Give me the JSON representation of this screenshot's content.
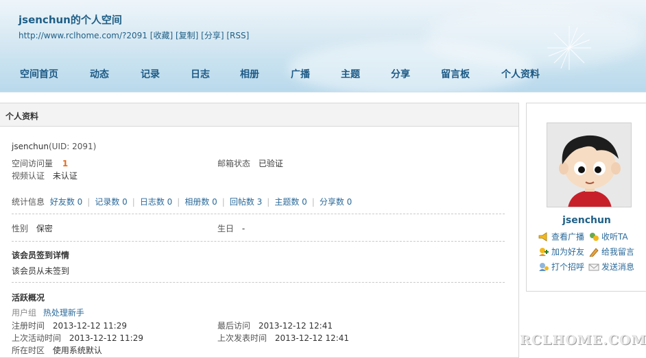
{
  "header": {
    "title": "jsenchun的个人空间",
    "url": "http://www.rclhome.com/?2091",
    "link_collect": "[收藏]",
    "link_copy": "[复制]",
    "link_share": "[分享]",
    "link_rss": "[RSS]"
  },
  "nav": [
    "空间首页",
    "动态",
    "记录",
    "日志",
    "相册",
    "广播",
    "主题",
    "分享",
    "留言板",
    "个人资料"
  ],
  "panel": {
    "heading": "个人资料",
    "username": "jsenchun",
    "uid": "(UID: 2091)",
    "visits_label": "空间访问量",
    "visits_value": "1",
    "email_label": "邮箱状态",
    "email_value": "已验证",
    "video_label": "视频认证",
    "video_value": "未认证",
    "stats_label": "统计信息",
    "stats": [
      "好友数 0",
      "记录数 0",
      "日志数 0",
      "相册数 0",
      "回帖数 3",
      "主题数 0",
      "分享数 0"
    ],
    "gender_label": "性别",
    "gender_value": "保密",
    "birthday_label": "生日",
    "birthday_value": "-",
    "checkin_title": "该会员签到详情",
    "checkin_text": "该会员从未签到",
    "activity_title": "活跃概况",
    "group_label": "用户组",
    "group_value": "热处理新手",
    "reg_label": "注册时间",
    "reg_value": "2013-12-12 11:29",
    "last_visit_label": "最后访问",
    "last_visit_value": "2013-12-12 12:41",
    "last_active_label": "上次活动时间",
    "last_active_value": "2013-12-12 11:29",
    "last_post_label": "上次发表时间",
    "last_post_value": "2013-12-12 12:41",
    "timezone_label": "所在时区",
    "timezone_value": "使用系统默认"
  },
  "side": {
    "username": "jsenchun",
    "actions": [
      {
        "label": "查看广播",
        "icon": "broadcast-icon"
      },
      {
        "label": "收听TA",
        "icon": "follow-icon"
      },
      {
        "label": "加为好友",
        "icon": "add-friend-icon"
      },
      {
        "label": "给我留言",
        "icon": "pencil-icon"
      },
      {
        "label": "打个招呼",
        "icon": "greet-icon"
      },
      {
        "label": "发送消息",
        "icon": "envelope-icon"
      }
    ]
  },
  "watermark": "RCLHOME.COM",
  "colors": {
    "link": "#2b6a9a",
    "nav": "#1d5a86",
    "accent": "#e56b1f"
  }
}
